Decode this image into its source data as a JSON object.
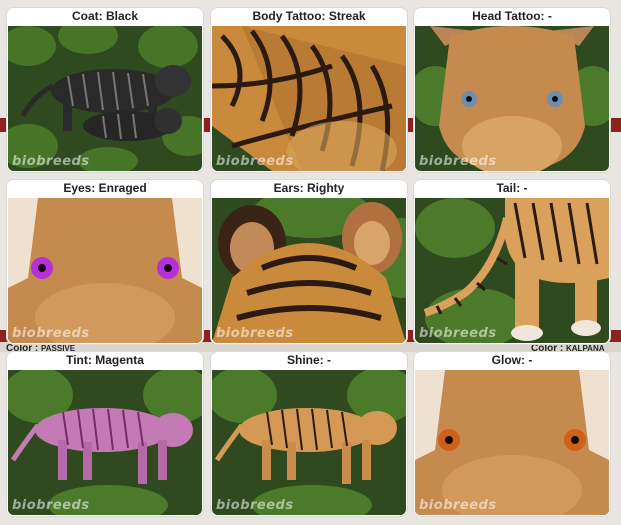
{
  "watermark": "biobreeds",
  "background_labels": {
    "left_color": "Color :",
    "left_value": "PASSIVE",
    "right_color": "Color :",
    "right_value": "KALPANA"
  },
  "traits": [
    {
      "label": "Coat: Black",
      "icon": "black-tiger-image",
      "accent": "#2a2a2a"
    },
    {
      "label": "Body Tattoo: Streak",
      "icon": "streak-tattoo-image",
      "accent": "#c98a3c"
    },
    {
      "label": "Head Tattoo: -",
      "icon": "head-tattoo-image",
      "accent": "#c9883e"
    },
    {
      "label": "Eyes: Enraged",
      "icon": "enraged-eyes-image",
      "accent": "#a030c8"
    },
    {
      "label": "Ears: Righty",
      "icon": "righty-ears-image",
      "accent": "#b97a40"
    },
    {
      "label": "Tail: -",
      "icon": "tail-image",
      "accent": "#d9a15c"
    },
    {
      "label": "Tint: Magenta",
      "icon": "magenta-tint-image",
      "accent": "#c47ab5"
    },
    {
      "label": "Shine: -",
      "icon": "shine-image",
      "accent": "#d49a55"
    },
    {
      "label": "Glow: -",
      "icon": "glow-image",
      "accent": "#d0601a"
    }
  ]
}
